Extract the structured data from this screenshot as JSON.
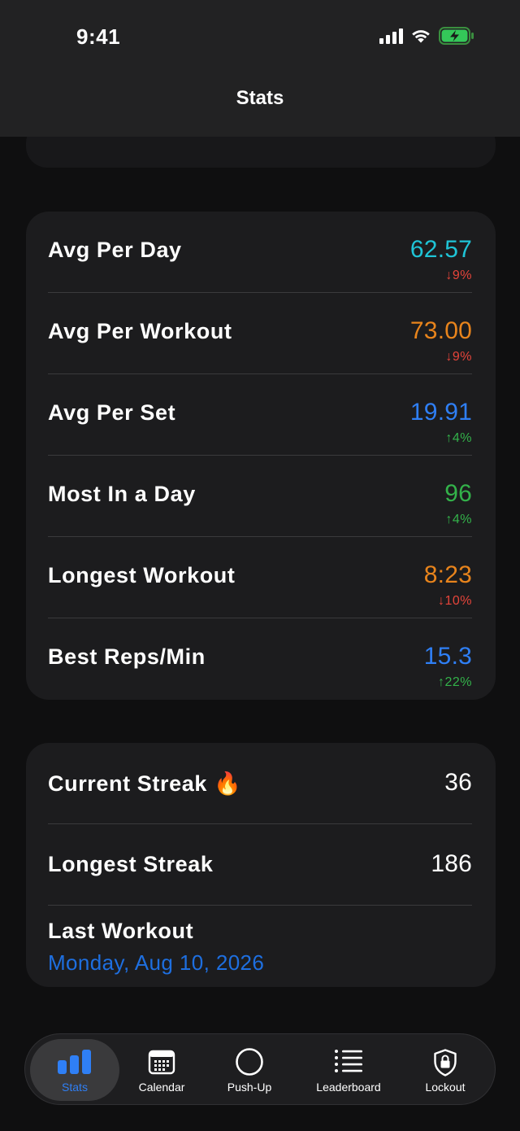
{
  "status_bar": {
    "time": "9:41"
  },
  "header": {
    "title": "Stats"
  },
  "stats": [
    {
      "label": "Avg Per Day",
      "value": "62.57",
      "change": "↓9%",
      "value_color": "#1fc4d6",
      "change_color": "#e5443a"
    },
    {
      "label": "Avg Per Workout",
      "value": "73.00",
      "change": "↓9%",
      "value_color": "#e8841c",
      "change_color": "#e5443a"
    },
    {
      "label": "Avg Per Set",
      "value": "19.91",
      "change": "↑4%",
      "value_color": "#2f7ff5",
      "change_color": "#33b24a"
    },
    {
      "label": "Most In a Day",
      "value": "96",
      "change": "↑4%",
      "value_color": "#33b24a",
      "change_color": "#33b24a"
    },
    {
      "label": "Longest Workout",
      "value": "8:23",
      "change": "↓10%",
      "value_color": "#e8841c",
      "change_color": "#e5443a"
    },
    {
      "label": "Best Reps/Min",
      "value": "15.3",
      "change": "↑22%",
      "value_color": "#2f7ff5",
      "change_color": "#33b24a"
    }
  ],
  "streak": {
    "current_label": "Current Streak 🔥",
    "current_value": "36",
    "longest_label": "Longest Streak",
    "longest_value": "186",
    "last_label": "Last Workout",
    "last_date": "Monday, Aug 10, 2026",
    "date_color": "#1e6fe0"
  },
  "tabs": [
    {
      "label": "Stats",
      "icon": "bar-chart-icon",
      "active": true
    },
    {
      "label": "Calendar",
      "icon": "calendar-icon",
      "active": false
    },
    {
      "label": "Push-Up",
      "icon": "circle-icon",
      "active": false
    },
    {
      "label": "Leaderboard",
      "icon": "list-icon",
      "active": false
    },
    {
      "label": "Lockout",
      "icon": "lock-shield-icon",
      "active": false
    }
  ]
}
